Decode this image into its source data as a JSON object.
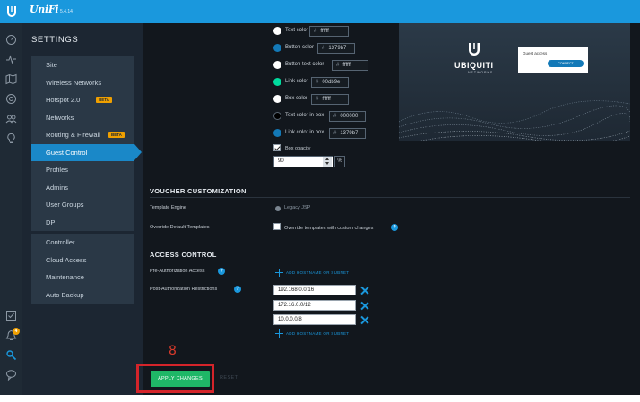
{
  "app": {
    "brand": "UniFi",
    "version": "5.4.14"
  },
  "rail_icons": [
    "dashboard-icon",
    "statistics-icon",
    "map-icon",
    "devices-icon",
    "clients-icon",
    "insights-icon",
    "events-icon",
    "alerts-icon",
    "settings-icon",
    "chat-icon"
  ],
  "alerts_count": "4",
  "settings": {
    "title": "SETTINGS",
    "group1": [
      {
        "label": "Site"
      },
      {
        "label": "Wireless Networks"
      },
      {
        "label": "Hotspot 2.0",
        "badge": "BETA"
      },
      {
        "label": "Networks"
      },
      {
        "label": "Routing & Firewall",
        "badge": "BETA"
      },
      {
        "label": "Guest Control",
        "active": true
      },
      {
        "label": "Profiles"
      },
      {
        "label": "Admins"
      },
      {
        "label": "User Groups"
      },
      {
        "label": "DPI"
      }
    ],
    "group2": [
      {
        "label": "Controller"
      },
      {
        "label": "Cloud Access"
      },
      {
        "label": "Maintenance"
      },
      {
        "label": "Auto Backup"
      }
    ]
  },
  "colors": {
    "text_color": {
      "label": "Text color",
      "hash": "#",
      "value": "ffffff",
      "swatch": "#ffffff"
    },
    "button_color": {
      "label": "Button color",
      "hash": "#",
      "value": "1379b7",
      "swatch": "#1379b7"
    },
    "button_text_color": {
      "label": "Button text color",
      "hash": "#",
      "value": "ffffff",
      "swatch": "#ffffff"
    },
    "link_color": {
      "label": "Link color",
      "hash": "#",
      "value": "00db9e",
      "swatch": "#00db9e"
    },
    "box_color": {
      "label": "Box color",
      "hash": "#",
      "value": "ffffff",
      "swatch": "#ffffff"
    },
    "text_color_in_box": {
      "label": "Text color in box",
      "hash": "#",
      "value": "000000",
      "swatch": "#000000"
    },
    "link_color_in_box": {
      "label": "Link color in box",
      "hash": "#",
      "value": "1379b7",
      "swatch": "#1379b7"
    }
  },
  "box_opacity": {
    "label": "Box opacity",
    "checked": true,
    "value": "90",
    "unit": "%"
  },
  "preview": {
    "brand": "UBIQUITI",
    "sub": "NETWORKS",
    "card_label": "Guest access",
    "card_button": "CONNECT"
  },
  "voucher": {
    "title": "VOUCHER CUSTOMIZATION",
    "template_engine_label": "Template Engine",
    "template_engine_value": "Legacy JSP",
    "override_label": "Override Default Templates",
    "override_text": "Override templates with custom changes"
  },
  "access": {
    "title": "ACCESS CONTROL",
    "pre_label": "Pre-Authorization Access",
    "post_label": "Post-Authorization Restrictions",
    "add_label": "ADD HOSTNAME OR SUBNET",
    "subnets": [
      "192.168.0.0/16",
      "172.16.0.0/12",
      "10.0.0.0/8"
    ]
  },
  "footer": {
    "apply": "APPLY CHANGES",
    "reset": "RESET"
  },
  "annotation": {
    "step": "8",
    "color": "#d4242a"
  }
}
